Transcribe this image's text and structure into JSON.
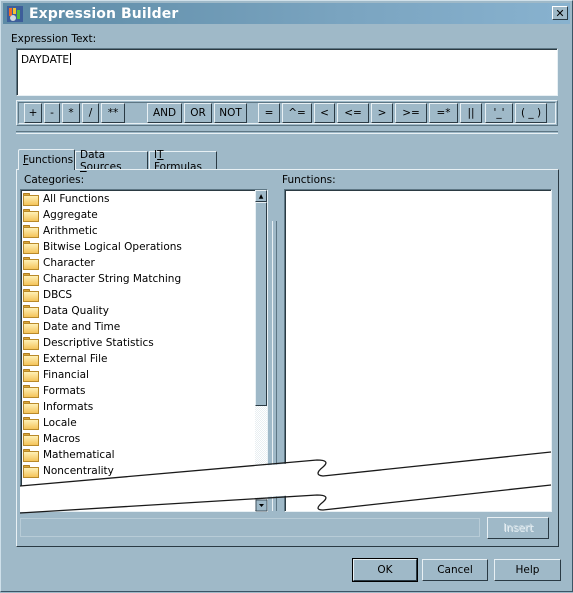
{
  "window": {
    "title": "Expression Builder",
    "icon": "sas-app-icon",
    "close_label": "×"
  },
  "expression": {
    "label": "Expression Text:",
    "value": "DAYDATE"
  },
  "operators": [
    {
      "label": "+",
      "name": "plus"
    },
    {
      "label": "-",
      "name": "minus"
    },
    {
      "label": "*",
      "name": "multiply"
    },
    {
      "label": "/",
      "name": "divide"
    },
    {
      "label": "**",
      "name": "power"
    },
    {
      "label": "AND",
      "name": "and"
    },
    {
      "label": "OR",
      "name": "or"
    },
    {
      "label": "NOT",
      "name": "not"
    },
    {
      "label": "=",
      "name": "equals"
    },
    {
      "label": "^=",
      "name": "not-equals"
    },
    {
      "label": "<",
      "name": "less-than"
    },
    {
      "label": "<=",
      "name": "less-equal"
    },
    {
      "label": ">",
      "name": "greater-than"
    },
    {
      "label": ">=",
      "name": "greater-equal"
    },
    {
      "label": "=*",
      "name": "sounds-like"
    },
    {
      "label": "||",
      "name": "concat"
    },
    {
      "label": "'_'",
      "name": "quotes"
    },
    {
      "label": "( _ )",
      "name": "parentheses"
    }
  ],
  "tabs": [
    {
      "label": "Functions",
      "mnemonic": "F",
      "rest": "unctions",
      "active": true
    },
    {
      "label": "Data Sources",
      "prefix": "Data ",
      "mnemonic": "S",
      "rest": "ources",
      "active": false
    },
    {
      "label": "IT Formulas",
      "prefix": "I",
      "mnemonic": "T",
      "rest": " Formulas",
      "active": false
    }
  ],
  "categories": {
    "label": "Categories:",
    "items": [
      "All Functions",
      "Aggregate",
      "Arithmetic",
      "Bitwise Logical Operations",
      "Character",
      "Character String Matching",
      "DBCS",
      "Data Quality",
      "Date and Time",
      "Descriptive Statistics",
      "External File",
      "Financial",
      "Formats",
      "Informats",
      "Locale",
      "Macros",
      "Mathematical",
      "Noncentrality"
    ]
  },
  "functions": {
    "label": "Functions:",
    "items": []
  },
  "buttons": {
    "insert": "Insert",
    "ok": "OK",
    "cancel": "Cancel",
    "help": "Help"
  }
}
